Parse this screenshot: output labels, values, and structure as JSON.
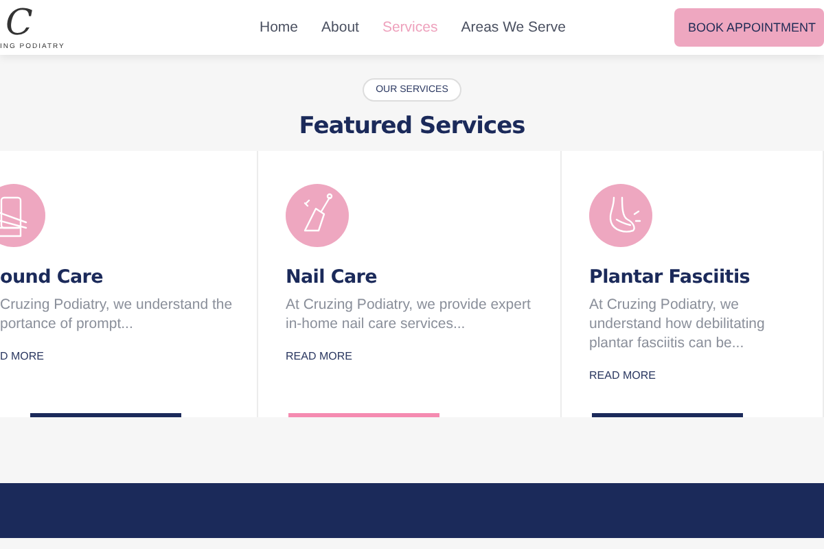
{
  "header": {
    "logo_mark": "C",
    "logo_text": "ING PODIATRY",
    "nav": [
      {
        "label": "Home",
        "selected": false
      },
      {
        "label": "About",
        "selected": false
      },
      {
        "label": "Services",
        "selected": true
      },
      {
        "label": "Areas We Serve",
        "selected": false
      }
    ],
    "cta": "BOOK APPOINTMENT"
  },
  "section": {
    "badge": "OUR SERVICES",
    "title": "Featured Services"
  },
  "cards": [
    {
      "kind": "bandage",
      "title": "ound Care",
      "text": "Cruzing Podiatry, we understand the portance of prompt...",
      "link": "D MORE",
      "selected": false
    },
    {
      "kind": "nail",
      "title": "Nail Care",
      "text": "At Cruzing Podiatry, we provide expert in-home nail care services...",
      "link": "READ MORE",
      "selected": true
    },
    {
      "kind": "foot",
      "title": "Plantar Fasciitis",
      "text": "At Cruzing Podiatry, we understand how debilitating plantar fasciitis can be...",
      "link": "READ MORE",
      "selected": false
    }
  ]
}
